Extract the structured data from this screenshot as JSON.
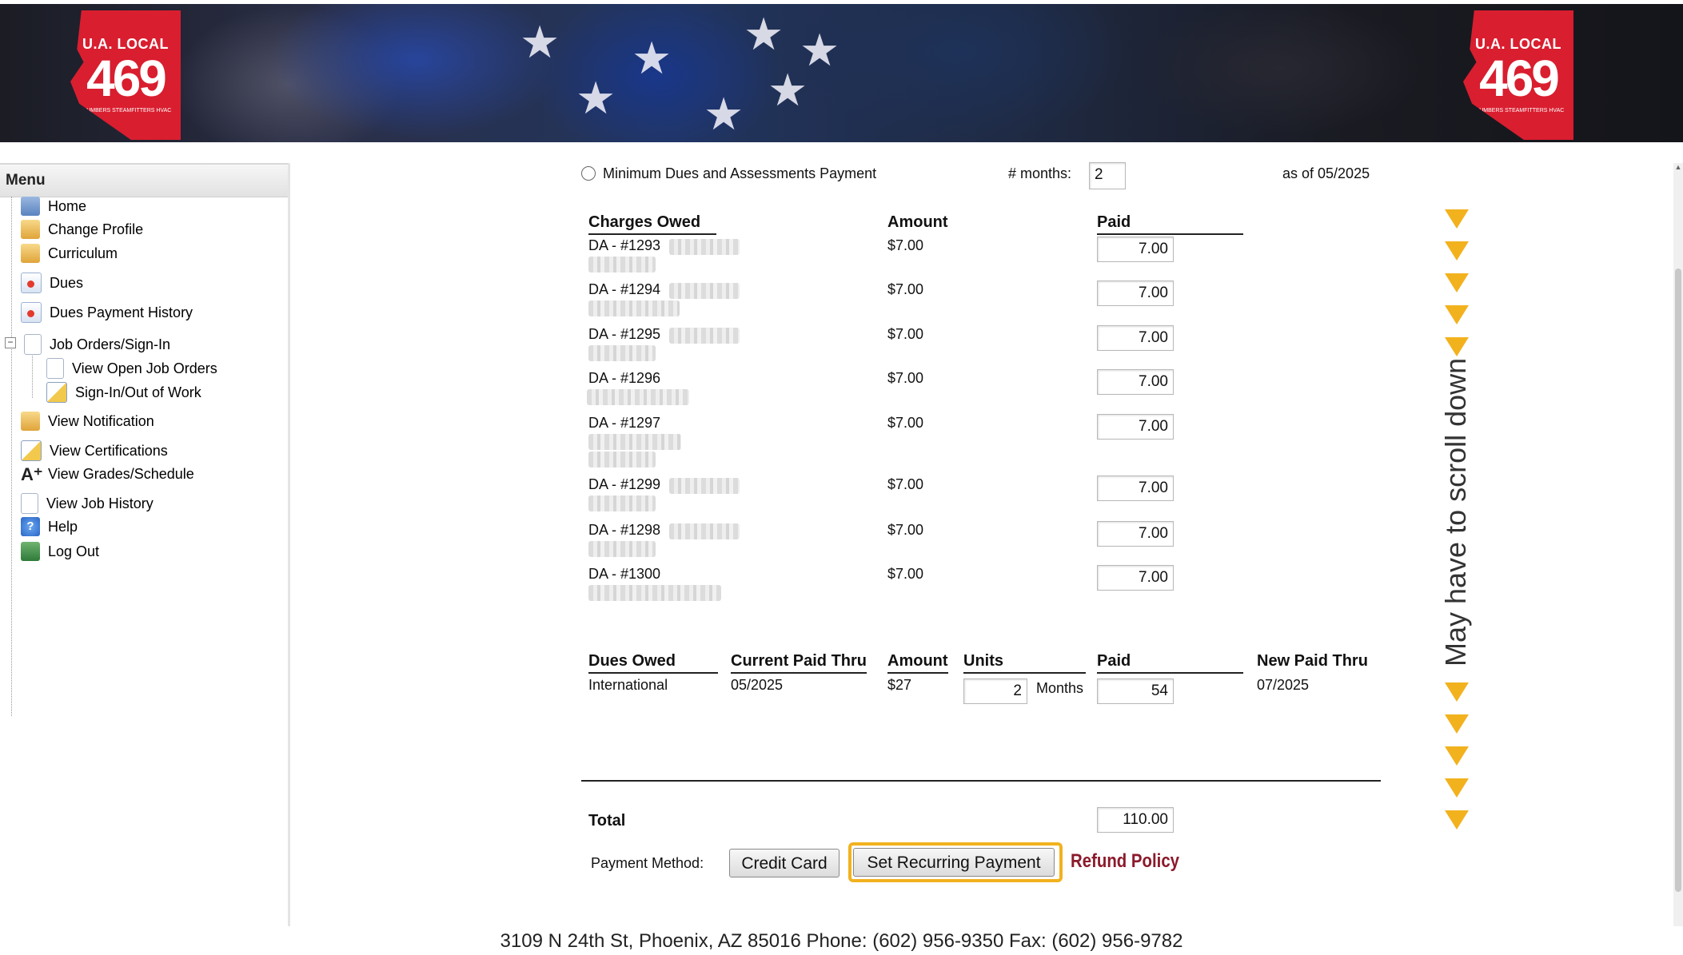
{
  "banner": {
    "logo_top": "U.A. LOCAL",
    "logo_number": "469",
    "logo_small": "PLUMBERS STEAMFITTERS HVAC"
  },
  "sidebar": {
    "title": "Menu",
    "items": [
      {
        "label": "Home",
        "icon": "home-icon"
      },
      {
        "label": "Change Profile",
        "icon": "lock-icon"
      },
      {
        "label": "Curriculum",
        "icon": "lock-icon"
      },
      {
        "label": "Dues",
        "icon": "dues-icon"
      },
      {
        "label": "Dues Payment History",
        "icon": "dues-icon"
      },
      {
        "label": "Job Orders/Sign-In",
        "icon": "document-icon"
      },
      {
        "label": "View Open Job Orders",
        "icon": "document-icon"
      },
      {
        "label": "Sign-In/Out of Work",
        "icon": "certificate-icon"
      },
      {
        "label": "View Notification",
        "icon": "lock-icon"
      },
      {
        "label": "View Certifications",
        "icon": "certificate-icon"
      },
      {
        "label": "View Grades/Schedule",
        "icon": "grade-icon"
      },
      {
        "label": "View Job History",
        "icon": "document-icon"
      },
      {
        "label": "Help",
        "icon": "help-icon"
      },
      {
        "label": "Log Out",
        "icon": "logout-icon"
      }
    ]
  },
  "payment_option": {
    "label": "Minimum Dues and Assessments Payment",
    "months_label": "# months:",
    "months_value": "2",
    "as_of": "as of 05/2025"
  },
  "charges": {
    "headers": {
      "charges": "Charges Owed",
      "amount": "Amount",
      "paid": "Paid"
    },
    "rows": [
      {
        "charge": "DA - #1293",
        "amount": "$7.00",
        "paid": "7.00"
      },
      {
        "charge": "DA - #1294",
        "amount": "$7.00",
        "paid": "7.00"
      },
      {
        "charge": "DA - #1295",
        "amount": "$7.00",
        "paid": "7.00"
      },
      {
        "charge": "DA - #1296",
        "amount": "$7.00",
        "paid": "7.00"
      },
      {
        "charge": "DA - #1297",
        "amount": "$7.00",
        "paid": "7.00"
      },
      {
        "charge": "DA - #1299",
        "amount": "$7.00",
        "paid": "7.00"
      },
      {
        "charge": "DA - #1298",
        "amount": "$7.00",
        "paid": "7.00"
      },
      {
        "charge": "DA - #1300",
        "amount": "$7.00",
        "paid": "7.00"
      }
    ]
  },
  "dues": {
    "headers": {
      "dues": "Dues Owed",
      "current": "Current Paid Thru",
      "amount": "Amount",
      "units": "Units",
      "paid": "Paid",
      "new": "New Paid Thru"
    },
    "row": {
      "dues": "International",
      "current": "05/2025",
      "amount": "$27",
      "units": "2",
      "units_suffix": "Months",
      "paid": "54",
      "new": "07/2025"
    }
  },
  "total": {
    "label": "Total",
    "value": "110.00"
  },
  "payment_method": {
    "label": "Payment Method:",
    "credit_card": "Credit Card",
    "recurring": "Set Recurring Payment",
    "refund_policy": "Refund Policy"
  },
  "annotation": {
    "scroll_hint": "May have to scroll down",
    "arrow_color": "#f2b21e"
  },
  "footer": {
    "address": "3109 N 24th St, Phoenix, AZ 85016  Phone: (602) 956-9350   Fax:  (602) 956-9782"
  }
}
